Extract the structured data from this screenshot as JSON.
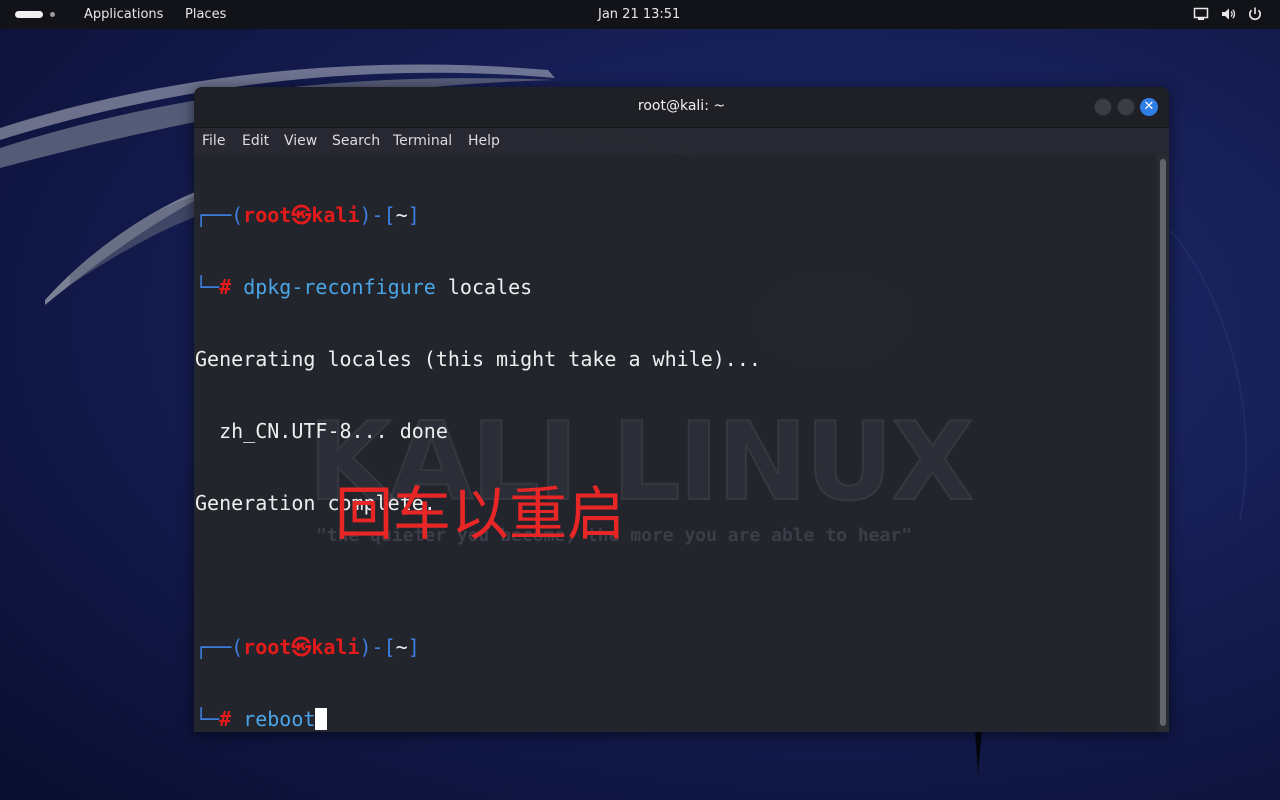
{
  "top_panel": {
    "menus": [
      "Applications",
      "Places"
    ],
    "clock": "Jan 21  13:51",
    "tray_icons": [
      "screen-icon",
      "volume-icon",
      "power-icon"
    ]
  },
  "window": {
    "title": "root@kali: ~",
    "menus": [
      "File",
      "Edit",
      "View",
      "Search",
      "Terminal",
      "Help"
    ]
  },
  "terminal": {
    "prompt": {
      "user": "root",
      "separator": "㉿",
      "host": "kali",
      "dir": "~",
      "symbol": "#"
    },
    "command1": {
      "name": "dpkg-reconfigure",
      "args": " locales"
    },
    "output": [
      "Generating locales (this might take a while)...",
      "  zh_CN.UTF-8... done",
      "Generation complete."
    ],
    "command2": "reboot"
  },
  "watermark": {
    "title": "KALI LINUX",
    "tagline": "\"the quieter you become, the more you are able to hear\""
  },
  "annotation": "回车以重启",
  "colors": {
    "prompt_frame": "#3d7fe0",
    "prompt_user": "#e31b1b",
    "command": "#4aa5e6",
    "annotation": "#e82626",
    "close_button": "#2f7ee6"
  }
}
